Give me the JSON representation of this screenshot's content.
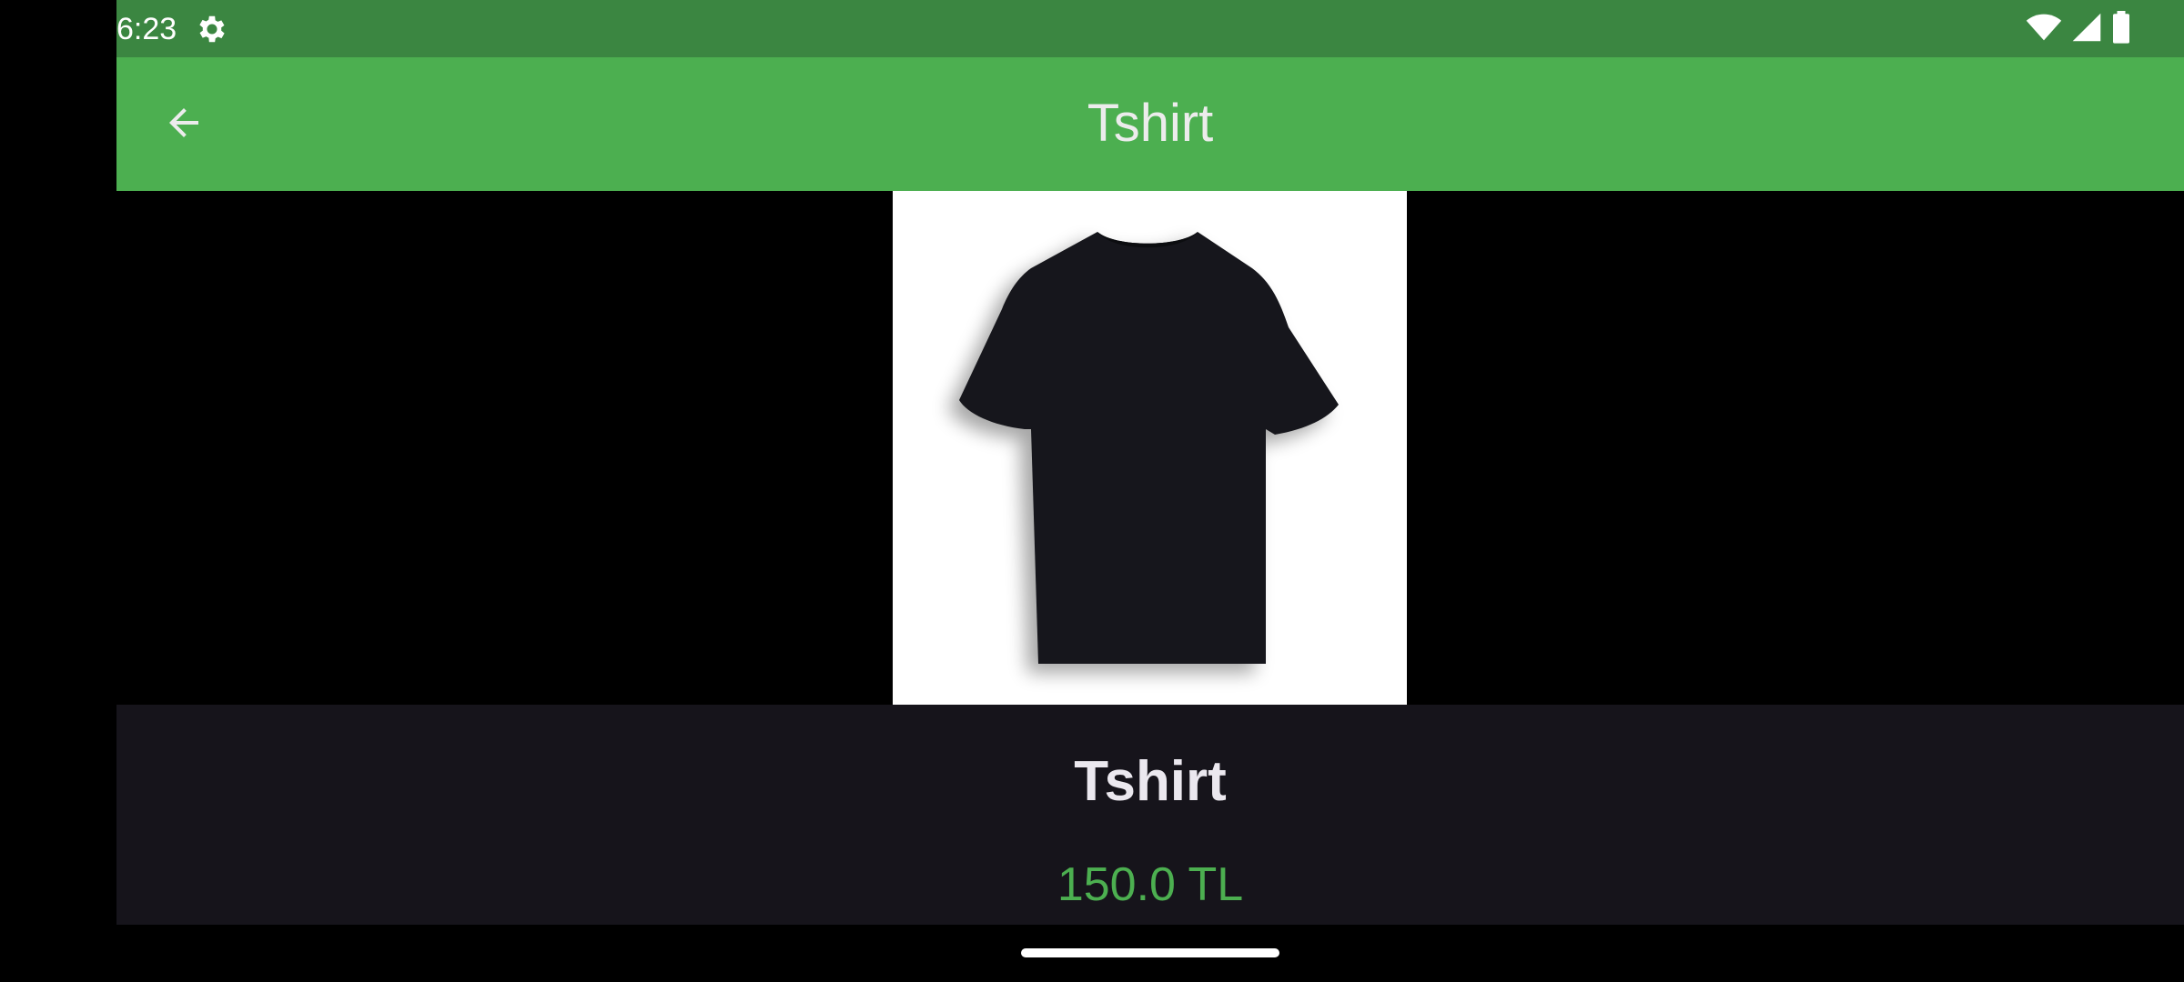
{
  "status_bar": {
    "time": "6:23",
    "icons": [
      "gear-icon",
      "wifi-icon",
      "signal-icon",
      "battery-icon"
    ]
  },
  "app_bar": {
    "title": "Tshirt",
    "back_icon": "arrow-back-icon",
    "color": "#4caf50"
  },
  "product": {
    "image_alt": "black t-shirt",
    "name": "Tshirt",
    "price": "150.0 TL",
    "price_color": "#4caf50"
  }
}
